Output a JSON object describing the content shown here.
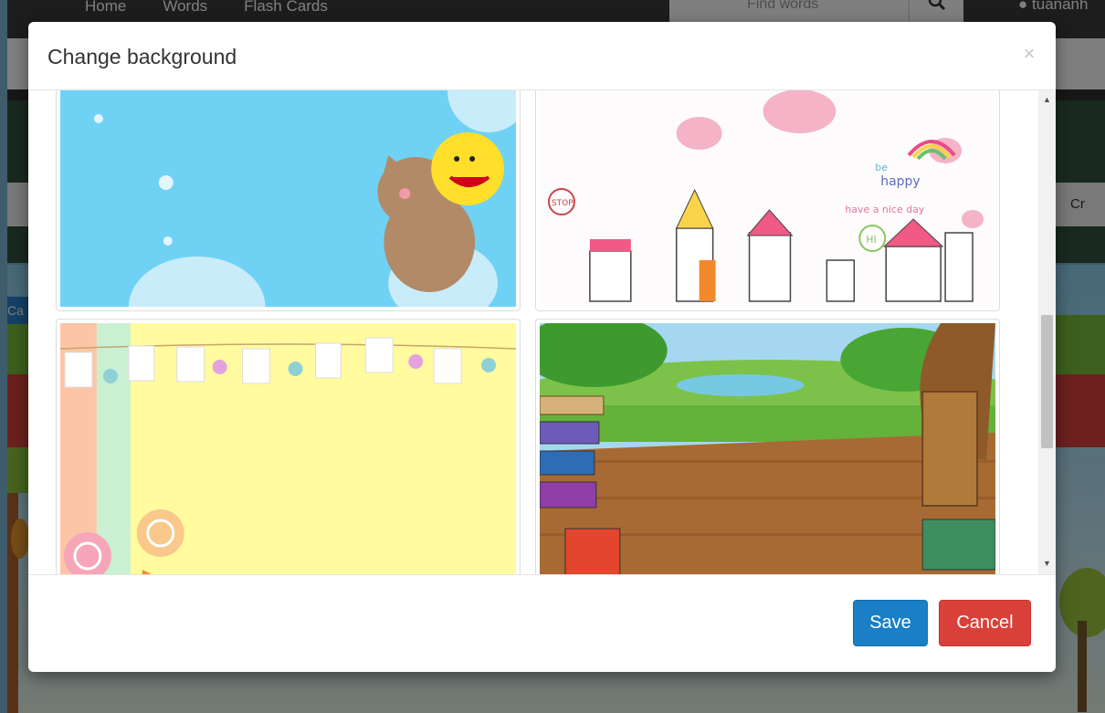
{
  "background_page": {
    "nav": [
      "Home",
      "Words",
      "Flash Cards"
    ],
    "search_placeholder": "Find words",
    "user": "tuananh",
    "toolbar_right": "Cr",
    "left_tab": "Ca"
  },
  "modal": {
    "title": "Change background",
    "close_label": "×",
    "thumbnails": [
      {
        "name": "bear-balloon-sky",
        "colors": {
          "bg": "#6fd2f5"
        }
      },
      {
        "name": "pink-town-happy",
        "colors": {
          "bg": "#fdfbfb"
        },
        "texts": [
          "be",
          "happy",
          "have a nice day",
          "HI",
          "STOP"
        ]
      },
      {
        "name": "yellow-clothesline",
        "colors": {
          "bg": "#fffb9e"
        }
      },
      {
        "name": "forest-books",
        "colors": {
          "bg": "#a5d8f0"
        }
      }
    ],
    "scroll": {
      "up": "▲",
      "down": "▼"
    },
    "buttons": {
      "save": "Save",
      "cancel": "Cancel"
    }
  }
}
